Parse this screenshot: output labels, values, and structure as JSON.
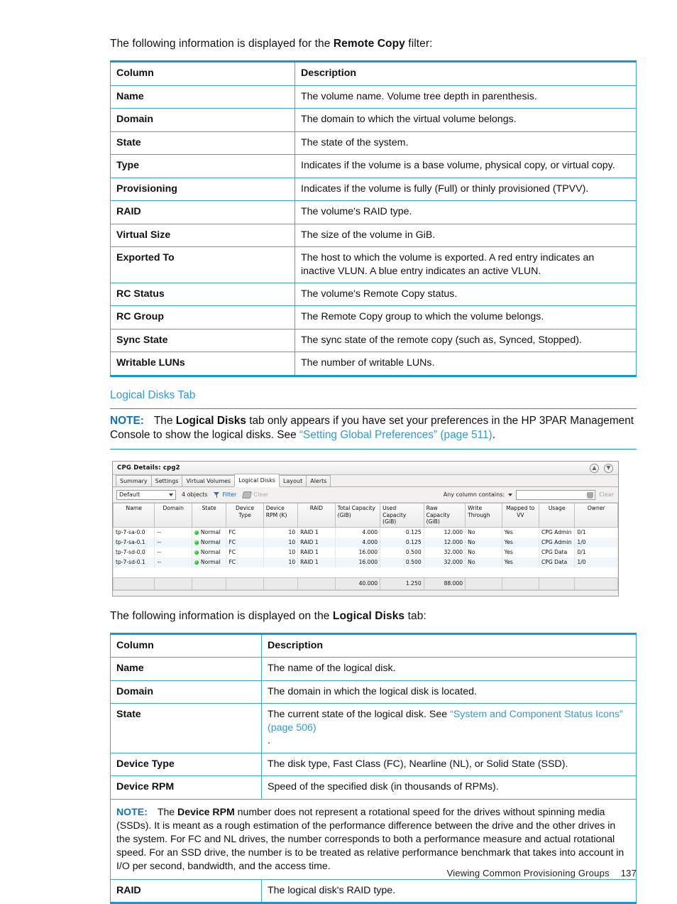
{
  "intro_remote_copy": {
    "prefix": "The following information is displayed for the ",
    "bold": "Remote Copy",
    "suffix": " filter:"
  },
  "remote_copy_table": {
    "header": {
      "col": "Column",
      "desc": "Description"
    },
    "rows": [
      {
        "col": "Name",
        "desc": "The volume name. Volume tree depth in parenthesis."
      },
      {
        "col": "Domain",
        "desc": "The domain to which the virtual volume belongs."
      },
      {
        "col": "State",
        "desc": "The state of the system."
      },
      {
        "col": "Type",
        "desc": "Indicates if the volume is a base volume, physical copy, or virtual copy."
      },
      {
        "col": "Provisioning",
        "desc": "Indicates if the volume is fully (Full) or thinly provisioned (TPVV)."
      },
      {
        "col": "RAID",
        "desc": "The volume's RAID type."
      },
      {
        "col": "Virtual Size",
        "desc": "The size of the volume in GiB."
      },
      {
        "col": "Exported To",
        "desc": "The host to which the volume is exported. A red entry indicates an inactive VLUN. A blue entry indicates an active VLUN."
      },
      {
        "col": "RC Status",
        "desc": "The volume's Remote Copy status."
      },
      {
        "col": "RC Group",
        "desc": "The Remote Copy group to which the volume belongs."
      },
      {
        "col": "Sync State",
        "desc": "The sync state of the remote copy (such as, Synced, Stopped)."
      },
      {
        "col": "Writable LUNs",
        "desc": "The number of writable LUNs."
      }
    ]
  },
  "section_heading": "Logical Disks Tab",
  "note_top": {
    "label": "NOTE:",
    "text_1": "The ",
    "bold_1": "Logical Disks",
    "text_2": " tab only appears if you have set your preferences in the HP 3PAR Management Console to show the logical disks. See ",
    "link": "“Setting Global Preferences” (page 511)",
    "text_3": "."
  },
  "app_screenshot": {
    "window_title": "CPG Details: cpg2",
    "title_icons": [
      "collapse-icon",
      "expand-icon"
    ],
    "tabs": [
      {
        "label": "Summary",
        "active": false
      },
      {
        "label": "Settings",
        "active": false
      },
      {
        "label": "Virtual Volumes",
        "active": false
      },
      {
        "label": "Logical Disks",
        "active": true
      },
      {
        "label": "Layout",
        "active": false
      },
      {
        "label": "Alerts",
        "active": false
      }
    ],
    "toolbar": {
      "view_select": "Default",
      "object_count": "4 objects",
      "filter_label": "Filter",
      "clear_label": "Clear",
      "any_column_label": "Any column contains:",
      "search_value": "",
      "search_clear_label": "Clear"
    },
    "grid": {
      "columns": [
        "Name",
        "Domain",
        "State",
        "Device Type",
        "Device RPM (K)",
        "RAID",
        "Total Capacity (GiB)",
        "Used Capacity (GiB)",
        "Raw Capacity (GiB)",
        "Write Through",
        "Mapped to VV",
        "Usage",
        "Owner"
      ],
      "rows": [
        {
          "name": "tp-7-sa-0.0",
          "domain": "--",
          "state": "Normal",
          "device_type": "FC",
          "device_rpm": "10",
          "raid": "RAID 1",
          "total_capacity": "4.000",
          "used_capacity": "0.125",
          "raw_capacity": "12.000",
          "write_through": "No",
          "mapped_to_vv": "Yes",
          "usage": "CPG Admin",
          "owner": "0/1"
        },
        {
          "name": "tp-7-sa-0.1",
          "domain": "--",
          "state": "Normal",
          "device_type": "FC",
          "device_rpm": "10",
          "raid": "RAID 1",
          "total_capacity": "4.000",
          "used_capacity": "0.125",
          "raw_capacity": "12.000",
          "write_through": "No",
          "mapped_to_vv": "Yes",
          "usage": "CPG Admin",
          "owner": "1/0"
        },
        {
          "name": "tp-7-sd-0.0",
          "domain": "--",
          "state": "Normal",
          "device_type": "FC",
          "device_rpm": "10",
          "raid": "RAID 1",
          "total_capacity": "16.000",
          "used_capacity": "0.500",
          "raw_capacity": "32.000",
          "write_through": "No",
          "mapped_to_vv": "Yes",
          "usage": "CPG Data",
          "owner": "0/1"
        },
        {
          "name": "tp-7-sd-0.1",
          "domain": "--",
          "state": "Normal",
          "device_type": "FC",
          "device_rpm": "10",
          "raid": "RAID 1",
          "total_capacity": "16.000",
          "used_capacity": "0.500",
          "raw_capacity": "32.000",
          "write_through": "No",
          "mapped_to_vv": "Yes",
          "usage": "CPG Data",
          "owner": "1/0"
        }
      ],
      "totals": {
        "total_capacity": "40.000",
        "used_capacity": "1.250",
        "raw_capacity": "88.000"
      }
    }
  },
  "intro_logical_disks": {
    "prefix": "The following information is displayed on the ",
    "bold": "Logical Disks",
    "suffix": " tab:"
  },
  "logical_disks_table": {
    "header": {
      "col": "Column",
      "desc": "Description"
    },
    "rows": [
      {
        "col": "Name",
        "desc": "The name of the logical disk."
      },
      {
        "col": "Domain",
        "desc": "The domain in which the logical disk is located."
      }
    ],
    "state_row": {
      "col": "State",
      "desc_1": "The current state of the logical disk. See ",
      "link": "“System and Component Status Icons” (page 506)",
      "desc_2": "."
    },
    "rows_2": [
      {
        "col": "Device Type",
        "desc": "The disk type, Fast Class (FC), Nearline (NL), or Solid State (SSD)."
      },
      {
        "col": "Device RPM",
        "desc": "Speed of the specified disk (in thousands of RPMs)."
      }
    ],
    "note_row": {
      "label": "NOTE:",
      "text_1": "The ",
      "bold_1": "Device RPM",
      "text_2": " number does not represent a rotational speed for the drives without spinning media (SSDs). It is meant as a rough estimation of the performance difference between the drive and the other drives in the system. For FC and NL drives, the number corresponds to both a performance measure and actual rotational speed. For an SSD drive, the number is to be treated as relative performance benchmark that takes into account in I/O per second, bandwidth, and the access time."
    },
    "last_row": {
      "col": "RAID",
      "desc": "The logical disk's RAID type."
    }
  },
  "footer": {
    "chapter": "Viewing Common Provisioning Groups",
    "page_number": "137"
  },
  "colors": {
    "accent_blue": "#0e9ada",
    "link_blue": "#2e9bd6",
    "note_label_blue": "#0e74b8",
    "status_green": "#16c116"
  }
}
